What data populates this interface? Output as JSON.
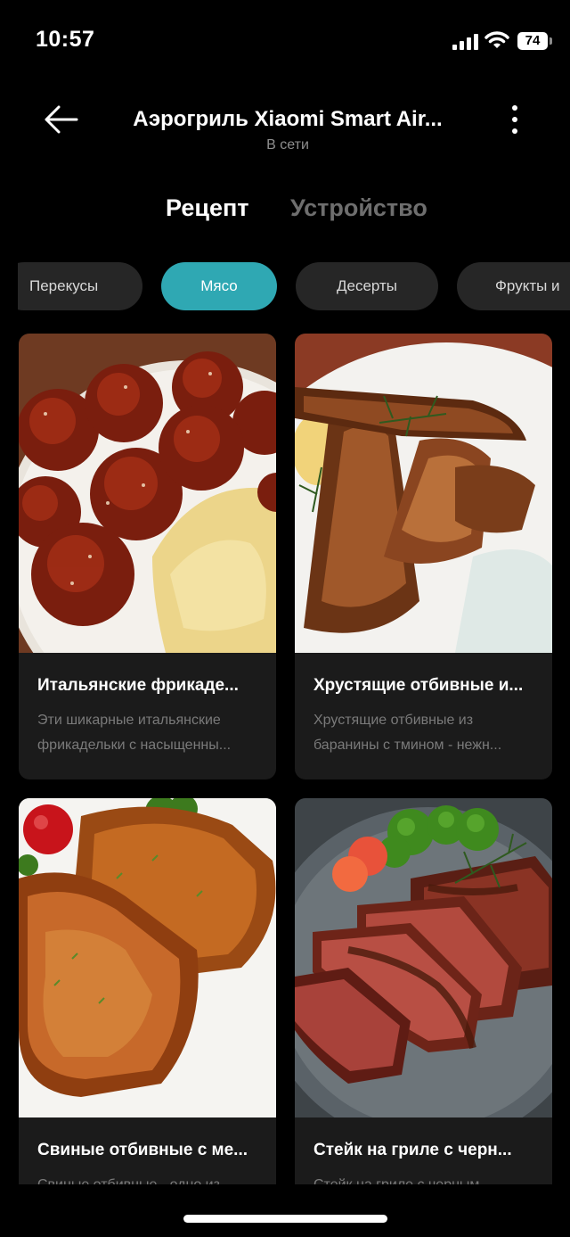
{
  "status_bar": {
    "time": "10:57",
    "battery": "74"
  },
  "header": {
    "title": "Аэрогриль Xiaomi Smart Air...",
    "subtitle": "В сети"
  },
  "tabs": [
    {
      "label": "Рецепт",
      "active": true
    },
    {
      "label": "Устройство",
      "active": false
    }
  ],
  "categories": [
    {
      "label": "Перекусы",
      "active": false
    },
    {
      "label": "Мясо",
      "active": true
    },
    {
      "label": "Десерты",
      "active": false
    },
    {
      "label": "Фрукты и",
      "active": false
    }
  ],
  "recipes": [
    {
      "name": "Итальянские фрикаде...",
      "desc": "Эти шикарные итальянские фрикадельки с насыщенны..."
    },
    {
      "name": "Хрустящие отбивные и...",
      "desc": "Хрустящие отбивные из баранины с тмином - нежн..."
    },
    {
      "name": "Свиные отбивные с ме...",
      "desc": "Свиные отбивные - одно из"
    },
    {
      "name": "Стейк на гриле с черн...",
      "desc": "Стейк на гриле с черным"
    }
  ],
  "colors": {
    "accent": "#2fa8b3",
    "card_bg": "#1b1b1b",
    "chip_bg": "#262626"
  }
}
